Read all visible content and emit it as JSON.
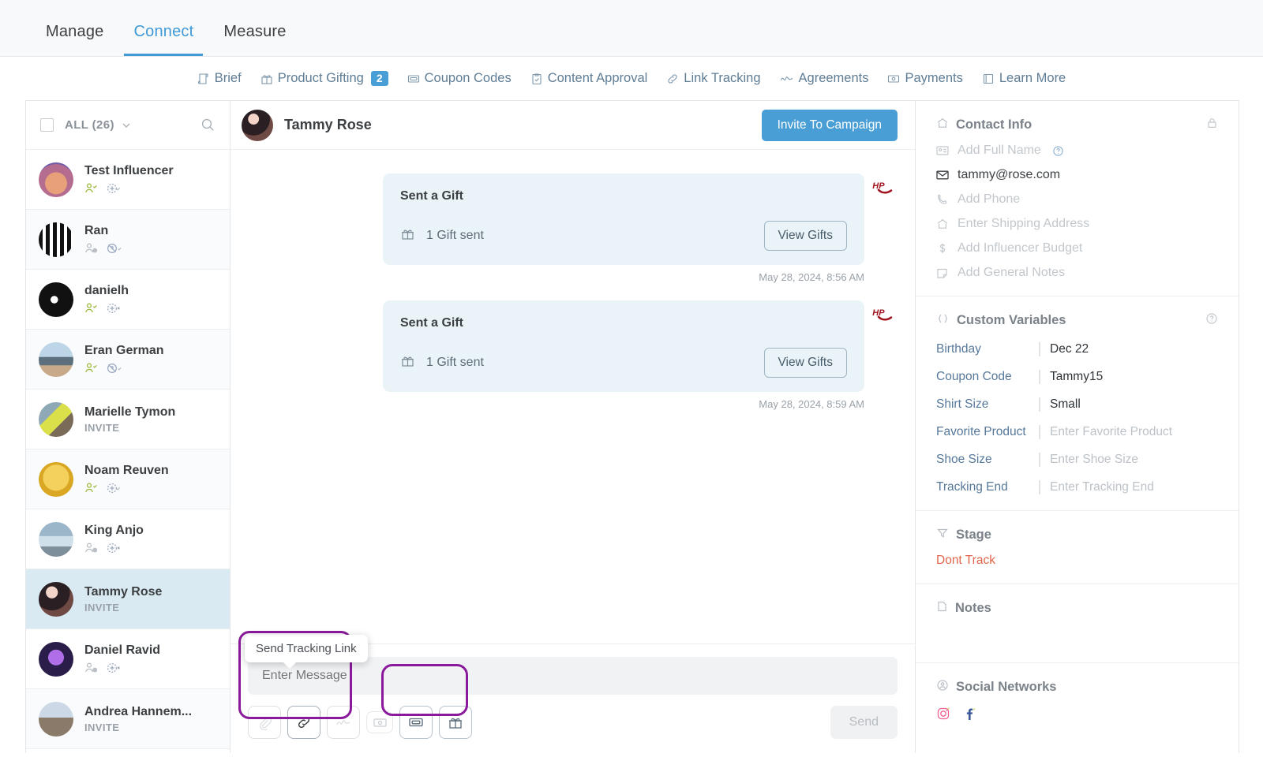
{
  "topbar": {
    "tabs": [
      {
        "label": "Manage",
        "active": false
      },
      {
        "label": "Connect",
        "active": true
      },
      {
        "label": "Measure",
        "active": false
      }
    ]
  },
  "subnav": {
    "items": [
      {
        "label": "Brief",
        "icon": "scroll-icon",
        "badge": ""
      },
      {
        "label": "Product Gifting",
        "icon": "gift-icon",
        "badge": "2"
      },
      {
        "label": "Coupon Codes",
        "icon": "ticket-icon",
        "badge": ""
      },
      {
        "label": "Content Approval",
        "icon": "clipboard-check-icon",
        "badge": ""
      },
      {
        "label": "Link Tracking",
        "icon": "link-icon",
        "badge": ""
      },
      {
        "label": "Agreements",
        "icon": "signature-icon",
        "badge": ""
      },
      {
        "label": "Payments",
        "icon": "payment-icon",
        "badge": ""
      },
      {
        "label": "Learn More",
        "icon": "book-icon",
        "badge": ""
      }
    ]
  },
  "sidebar": {
    "filter_label": "ALL (26)",
    "search_icon": "search-icon",
    "items": [
      {
        "name": "Test Influencer",
        "sub": "",
        "status": "accepted",
        "selected": false
      },
      {
        "name": "Ran",
        "sub": "",
        "status": "pending-blocked",
        "selected": false
      },
      {
        "name": "danielh",
        "sub": "",
        "status": "accepted-x",
        "selected": false
      },
      {
        "name": "Eran German",
        "sub": "",
        "status": "accepted-blocked",
        "selected": false
      },
      {
        "name": "Marielle Tymon",
        "sub": "INVITE",
        "status": "none",
        "selected": false
      },
      {
        "name": "Noam Reuven",
        "sub": "",
        "status": "accepted",
        "selected": false
      },
      {
        "name": "King Anjo",
        "sub": "",
        "status": "pending-x",
        "selected": false
      },
      {
        "name": "Tammy Rose",
        "sub": "INVITE",
        "status": "none",
        "selected": true
      },
      {
        "name": "Daniel Ravid",
        "sub": "",
        "status": "pending-x",
        "selected": false
      },
      {
        "name": "Andrea Hannem...",
        "sub": "INVITE",
        "status": "none",
        "selected": false
      }
    ]
  },
  "chat": {
    "contact_name": "Tammy Rose",
    "invite_button": "Invite To Campaign",
    "messages": [
      {
        "title": "Sent a Gift",
        "detail": "1 Gift sent",
        "action": "View Gifts",
        "time": "May 28, 2024, 8:56 AM",
        "brand": "HP"
      },
      {
        "title": "Sent a Gift",
        "detail": "1 Gift sent",
        "action": "View Gifts",
        "time": "May 28, 2024, 8:59 AM",
        "brand": "HP"
      }
    ]
  },
  "composer": {
    "placeholder": "Enter Message",
    "send_label": "Send",
    "tooltip": "Send Tracking Link",
    "tools": [
      {
        "name": "attachment-icon",
        "state": "disabled"
      },
      {
        "name": "link-icon",
        "state": "active"
      },
      {
        "name": "signature-icon",
        "state": "disabled"
      },
      {
        "name": "payment-icon",
        "state": "disabled"
      },
      {
        "name": "coupon-icon",
        "state": "normal"
      },
      {
        "name": "gift-icon",
        "state": "normal"
      }
    ]
  },
  "right": {
    "contact_info": {
      "title": "Contact Info",
      "lock_icon": "lock-icon",
      "rows": [
        {
          "label": "Add Full Name",
          "icon": "id-card-icon",
          "filled": false,
          "help": true
        },
        {
          "label": "tammy@rose.com",
          "icon": "envelope-icon",
          "filled": true,
          "help": false
        },
        {
          "label": "Add Phone",
          "icon": "phone-icon",
          "filled": false,
          "help": false
        },
        {
          "label": "Enter Shipping Address",
          "icon": "home-icon",
          "filled": false,
          "help": false
        },
        {
          "label": "Add Influencer Budget",
          "icon": "dollar-icon",
          "filled": false,
          "help": false
        },
        {
          "label": "Add General Notes",
          "icon": "note-icon",
          "filled": false,
          "help": false
        }
      ]
    },
    "custom_variables": {
      "title": "Custom Variables",
      "help_icon": "question-circle-icon",
      "rows": [
        {
          "key": "Birthday",
          "value": "Dec 22",
          "placeholder": false
        },
        {
          "key": "Coupon Code",
          "value": "Tammy15",
          "placeholder": false
        },
        {
          "key": "Shirt Size",
          "value": "Small",
          "placeholder": false
        },
        {
          "key": "Favorite Product",
          "value": "Enter Favorite Product",
          "placeholder": true
        },
        {
          "key": "Shoe Size",
          "value": "Enter Shoe Size",
          "placeholder": true
        },
        {
          "key": "Tracking End",
          "value": "Enter Tracking End",
          "placeholder": true
        }
      ]
    },
    "stage": {
      "title": "Stage",
      "value": "Dont Track"
    },
    "notes": {
      "title": "Notes"
    },
    "social": {
      "title": "Social Networks",
      "networks": [
        {
          "name": "instagram-icon",
          "color": "#f06292"
        },
        {
          "name": "facebook-icon",
          "color": "#3b5998"
        }
      ]
    }
  },
  "colors": {
    "accent": "#4a9ed6",
    "highlight": "#8a1a9b",
    "stage": "#e0654a",
    "bubble": "#eaf4f8"
  }
}
